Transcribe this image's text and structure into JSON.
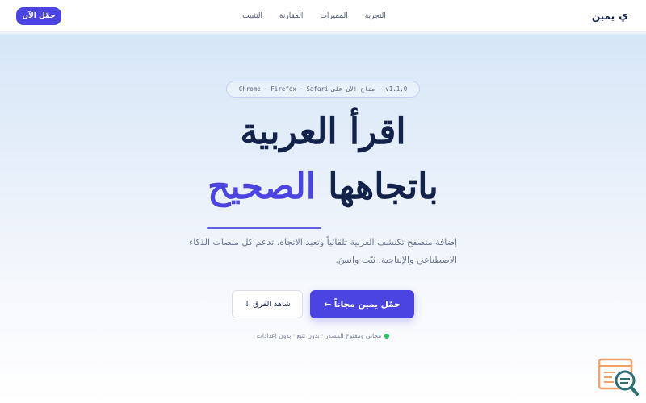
{
  "header": {
    "brand_name": "يمين",
    "brand_logo": "ي",
    "nav": [
      "التجربة",
      "المميزات",
      "المقارنة",
      "التثبيت"
    ],
    "cta": "حمّل الآن"
  },
  "badge": {
    "version": "v1.1.0",
    "availability": "متاح الآن على",
    "browsers": [
      "Safari",
      "Firefox",
      "Chrome"
    ]
  },
  "hero": {
    "title_line1": "اقرأ العربية",
    "title_line2_main": "باتجاهها",
    "title_line2_accent": "الصحيح",
    "subtitle": "إضافة متصفح تكتشف العربية تلقائياً وتعيد الاتجاه. تدعم كل منصات الذكاء الاصطناعي والإنتاجية. ثبّت وانسَ."
  },
  "actions": {
    "primary": "حمّل يمين مجاناً ←",
    "secondary": "شاهد الفرق ↓"
  },
  "meta": "مجاني ومفتوح المصدر · بدون تتبع · بدون إعدادات",
  "colors": {
    "accent": "#4c44e0",
    "navy": "#13224a",
    "green": "#22c55e",
    "widget_orange": "#f0a06a",
    "widget_teal": "#2b6f77"
  },
  "icons": {
    "brand": "yamin-logo-icon",
    "widget": "search-zoom-icon"
  }
}
